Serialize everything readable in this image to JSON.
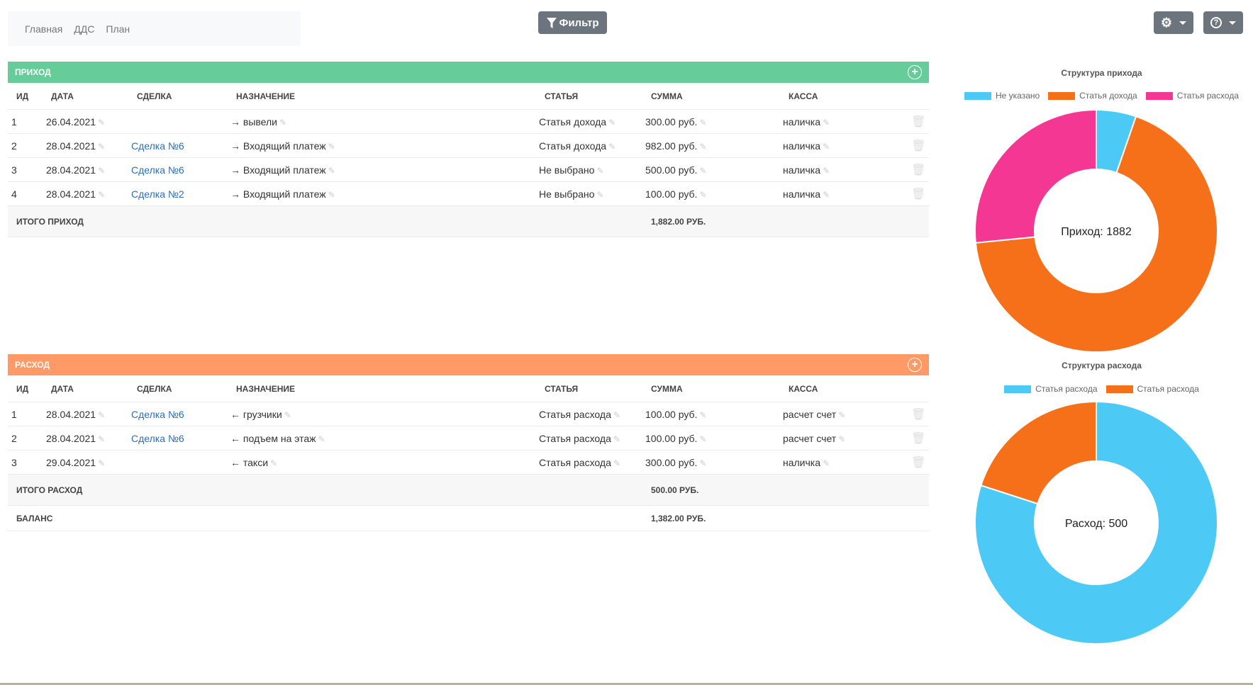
{
  "nav": {
    "items": [
      "Главная",
      "ДДС",
      "План"
    ]
  },
  "toolbar": {
    "filter_label": "Фильтр"
  },
  "columns": [
    "ИД",
    "ДАТА",
    "СДЕЛКА",
    "НАЗНАЧЕНИЕ",
    "СТАТЬЯ",
    "СУММА",
    "КАССА"
  ],
  "income": {
    "title": "ПРИХОД",
    "color": "#66cc99",
    "rows": [
      {
        "id": "1",
        "date": "26.04.2021",
        "deal": "",
        "purpose": "→ вывели",
        "article": "Статья дохода",
        "sum": "300.00 руб.",
        "kassa": "наличка"
      },
      {
        "id": "2",
        "date": "28.04.2021",
        "deal": "Сделка №6",
        "purpose": "→ Входящий платеж",
        "article": "Статья дохода",
        "sum": "982.00 руб.",
        "kassa": "наличка"
      },
      {
        "id": "3",
        "date": "28.04.2021",
        "deal": "Сделка №6",
        "purpose": "→ Входящий платеж",
        "article": "Не выбрано",
        "sum": "500.00 руб.",
        "kassa": "наличка"
      },
      {
        "id": "4",
        "date": "28.04.2021",
        "deal": "Сделка №2",
        "purpose": "→ Входящий платеж",
        "article": "Не выбрано",
        "sum": "100.00 руб.",
        "kassa": "наличка"
      }
    ],
    "total_label": "ИТОГО ПРИХОД",
    "total": "1,882.00 РУБ."
  },
  "expense": {
    "title": "РАСХОД",
    "color": "#ff9966",
    "rows": [
      {
        "id": "1",
        "date": "28.04.2021",
        "deal": "Сделка №6",
        "purpose": "← грузчики",
        "article": "Статья расхода",
        "sum": "100.00 руб.",
        "kassa": "расчет счет"
      },
      {
        "id": "2",
        "date": "28.04.2021",
        "deal": "Сделка №6",
        "purpose": "← подъем на этаж",
        "article": "Статья расхода",
        "sum": "100.00 руб.",
        "kassa": "расчет счет"
      },
      {
        "id": "3",
        "date": "29.04.2021",
        "deal": "",
        "purpose": "← такси",
        "article": "Статья расхода",
        "sum": "300.00 руб.",
        "kassa": "наличка"
      }
    ],
    "total_label": "ИТОГО РАСХОД",
    "total": "500.00 РУБ.",
    "balance_label": "БАЛАНС",
    "balance": "1,382.00 РУБ."
  },
  "chart_data": [
    {
      "type": "pie",
      "title": "Структура прихода",
      "center_label": "Приход: 1882",
      "categories": [
        "Не указано",
        "Статья дохода",
        "Статья расхода"
      ],
      "values": [
        100,
        1282,
        500
      ],
      "colors": [
        "#4dc9f6",
        "#f67019",
        "#f53794"
      ]
    },
    {
      "type": "pie",
      "title": "Структура расхода",
      "center_label": "Расход: 500",
      "categories": [
        "Статья расхода",
        "Статья расхода"
      ],
      "values": [
        400,
        100
      ],
      "colors": [
        "#4dc9f6",
        "#f67019"
      ]
    }
  ]
}
